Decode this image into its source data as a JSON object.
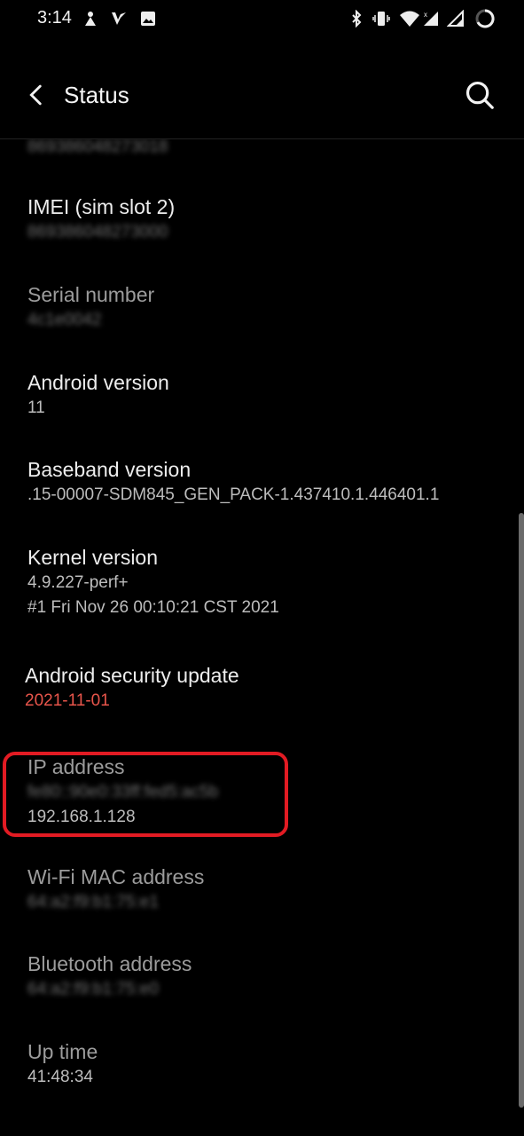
{
  "status_bar": {
    "time": "3:14",
    "left_icons": [
      "teamviewer-icon",
      "vivaldi-icon",
      "image-icon"
    ],
    "right_icons": [
      "bluetooth-icon",
      "vibrate-icon",
      "wifi-icon",
      "signal-icon",
      "signal-2-icon",
      "battery-ring-icon"
    ]
  },
  "app_bar": {
    "title": "Status",
    "back_icon": "back-arrow-icon",
    "search_icon": "search-icon"
  },
  "items": [
    {
      "value": "869386048273018"
    },
    {
      "label": "IMEI (sim slot 2)",
      "value": "869386048273000"
    },
    {
      "label": "Serial number",
      "value": "4c1e0042"
    },
    {
      "label": "Android version",
      "value": "11"
    },
    {
      "label": "Baseband version",
      "value": ".15-00007-SDM845_GEN_PACK-1.437410.1.446401.1"
    },
    {
      "label": "Kernel version",
      "value": "4.9.227-perf+",
      "value2": "#1 Fri Nov 26 00:10:21 CST 2021"
    },
    {
      "label": "Android security update",
      "value": "2021-11-01"
    },
    {
      "label": "IP address",
      "value": "fe80::90e0:33ff:fed5:ac5b",
      "value2": "192.168.1.128"
    },
    {
      "label": "Wi-Fi MAC address",
      "value": "64:a2:f9:b1:75:e1"
    },
    {
      "label": "Bluetooth address",
      "value": "64:a2:f9:b1:75:e0"
    },
    {
      "label": "Up time",
      "value": "41:48:34"
    }
  ],
  "colors": {
    "background": "#000000",
    "accent_value": "#e8554b",
    "highlight_box": "#e21b23"
  }
}
